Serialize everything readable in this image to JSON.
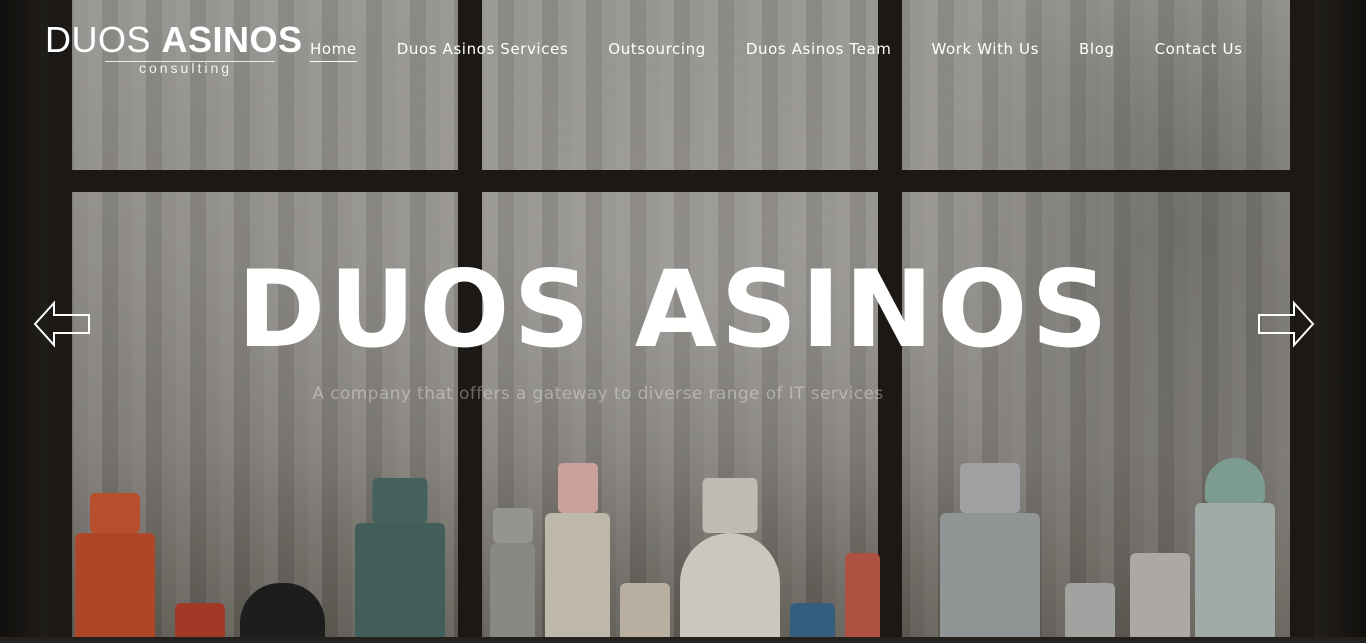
{
  "logo": {
    "word1": "DUOS",
    "word2": "ASINOS",
    "sub": "consulting"
  },
  "nav": {
    "items": [
      {
        "label": "Home",
        "active": true
      },
      {
        "label": "Duos Asinos Services",
        "active": false
      },
      {
        "label": "Outsourcing",
        "active": false
      },
      {
        "label": "Duos Asinos Team",
        "active": false
      },
      {
        "label": "Work With Us",
        "active": false
      },
      {
        "label": "Blog",
        "active": false
      },
      {
        "label": "Contact Us",
        "active": false
      }
    ]
  },
  "hero": {
    "title": "DUOS ASINOS",
    "subtitle": "A company that offers a gateway to diverse range of IT services"
  },
  "slider": {
    "prev_icon": "arrow-left-icon",
    "next_icon": "arrow-right-icon"
  },
  "colors": {
    "text": "#ffffff",
    "frame": "#1f1c19",
    "background": "#1a1816"
  }
}
